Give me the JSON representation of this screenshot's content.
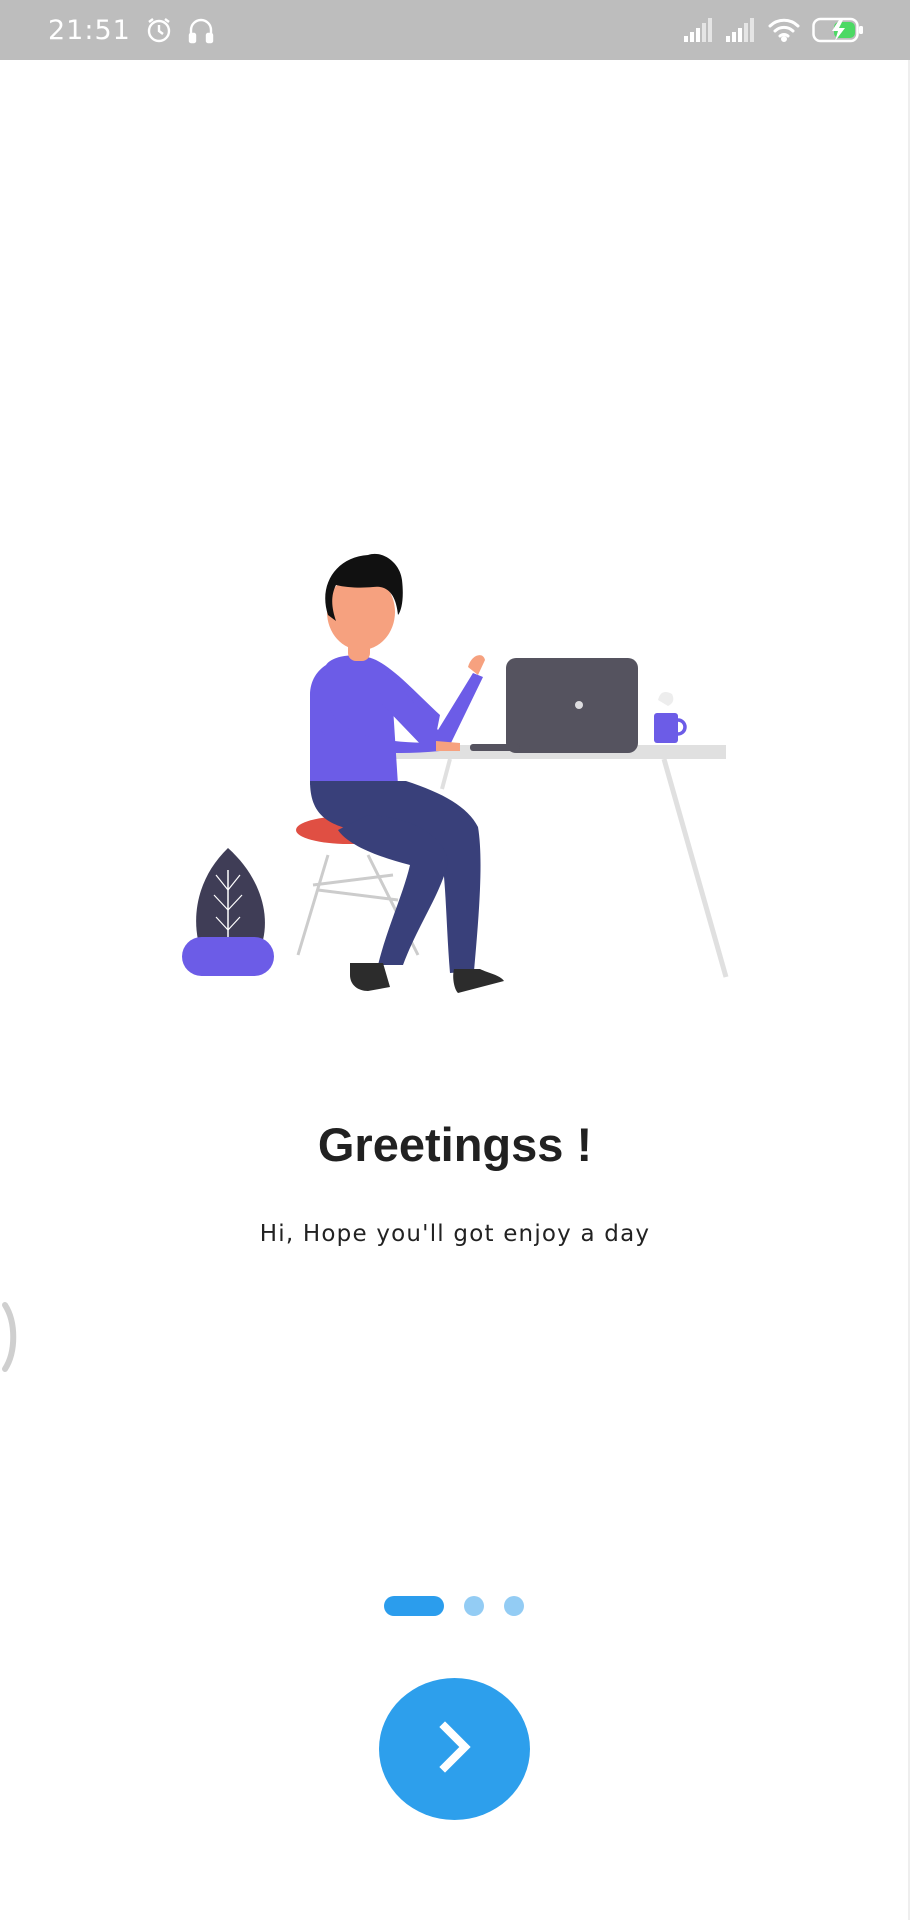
{
  "status_bar": {
    "time": "21:51",
    "icons": [
      "alarm-icon",
      "headphones-icon",
      "signal-icon",
      "signal-icon",
      "wifi-icon",
      "battery-charging-icon"
    ]
  },
  "onboarding": {
    "illustration": "person-working-at-laptop",
    "title": "Greetingss !",
    "subtitle": "Hi, Hope you'll got enjoy a day",
    "page_indicator": {
      "total": 3,
      "current": 1
    },
    "next_button_icon": "chevron-right-icon"
  },
  "colors": {
    "accent": "#2d9fec",
    "indicator_inactive": "#93ccf4",
    "status_bar": "#bdbdbd",
    "illustration_purple": "#6c5ce7",
    "text": "#212121"
  }
}
